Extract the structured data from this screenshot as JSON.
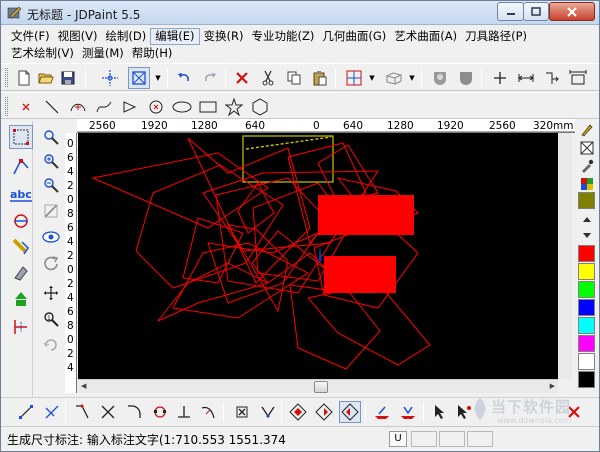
{
  "window": {
    "title": "无标题 - JDPaint 5.5",
    "app_icon": "jdpaint-app-icon",
    "controls": [
      "minimize-icon",
      "maximize-icon",
      "close-icon"
    ]
  },
  "menu": {
    "row1": [
      {
        "label": "文件(F)"
      },
      {
        "label": "视图(V)"
      },
      {
        "label": "绘制(D)"
      },
      {
        "label": "编辑(E)",
        "active": true
      },
      {
        "label": "变换(R)"
      },
      {
        "label": "专业功能(Z)"
      },
      {
        "label": "几何曲面(G)"
      },
      {
        "label": "艺术曲面(A)"
      },
      {
        "label": "刀具路径(P)"
      }
    ],
    "row2": [
      {
        "label": "艺术绘制(V)"
      },
      {
        "label": "测量(M)"
      },
      {
        "label": "帮助(H)"
      }
    ]
  },
  "toolbar_main": {
    "buttons": [
      "new-file-icon",
      "open-file-icon",
      "save-icon",
      "crosshair-icon",
      "select-box-icon",
      "undo-icon",
      "redo-icon",
      "delete-icon",
      "cut-icon",
      "copy-icon",
      "paste-icon",
      "snap-grid-icon",
      "3d-view-icon",
      "shade-toggle-icon",
      "surface-shade-icon",
      "add-point-icon",
      "measure-distance-icon",
      "align-icon",
      "dimension-icon"
    ]
  },
  "toolbar_draw": {
    "buttons": [
      "point-icon",
      "line-icon",
      "arc-icon",
      "spline-icon",
      "polyline-icon",
      "circle-icon",
      "ellipse-icon",
      "rectangle-icon",
      "star-icon",
      "polygon-icon"
    ]
  },
  "ruler": {
    "top_labels": [
      "2560",
      "1920",
      "1280",
      "640",
      "0",
      "640",
      "1280",
      "1920",
      "2560",
      "320mm"
    ],
    "left_labels": [
      "0",
      "6",
      "4",
      "2",
      "0",
      "8",
      "6",
      "4",
      "2",
      "0",
      "2",
      "4",
      "6",
      "8",
      "0",
      "2",
      "4"
    ]
  },
  "colors": {
    "canvas_bg": "#000000",
    "stroke_red": "#ff0000",
    "selection_yellow": "#c8c800",
    "fill_red": "#ff0000",
    "palette": [
      "#808000",
      "#ff0000",
      "#ffff00",
      "#00ff00",
      "#0000ff",
      "#00ffff",
      "#ff00ff",
      "#ffffff",
      "#000000"
    ]
  },
  "palette_tools": [
    "pen-icon",
    "fill-toggle-icon",
    "eyedropper-icon",
    "color-mode-icon",
    "scroll-up-icon",
    "scroll-down-icon"
  ],
  "left_tools": [
    "select-icon",
    "node-edit-icon",
    "text-tool-icon",
    "transform-icon",
    "mirror-icon",
    "eraser-icon",
    "fill-tool-icon",
    "node-align-icon"
  ],
  "view_tools": [
    "zoom-window-icon",
    "zoom-in-icon",
    "zoom-out-icon",
    "zoom-fit-icon",
    "eye-view-icon",
    "refresh-view-icon",
    "pan-icon",
    "zoom-real-icon",
    "rotate-view-icon"
  ],
  "toolbar_bottom": {
    "buttons": [
      "line-tool-icon",
      "trim-icon",
      "corner-icon",
      "cross-trim-icon",
      "arc-corner-icon",
      "circle-node-icon",
      "perpendicular-icon",
      "curve-tool-icon",
      "box-node-icon",
      "vertex-icon",
      "diamond-icon",
      "diamond2-icon",
      "diamond3-icon",
      "layer-icon",
      "layer2-icon",
      "cursor-icon",
      "cursor2-icon",
      "close-icon"
    ]
  },
  "status": {
    "prompt": "生成尺寸标注: 输入标注文字(1:710.553  1551.374",
    "ime_flag": "U"
  },
  "watermark": {
    "text": "当下软件园",
    "sub": "www.downxia.com"
  }
}
